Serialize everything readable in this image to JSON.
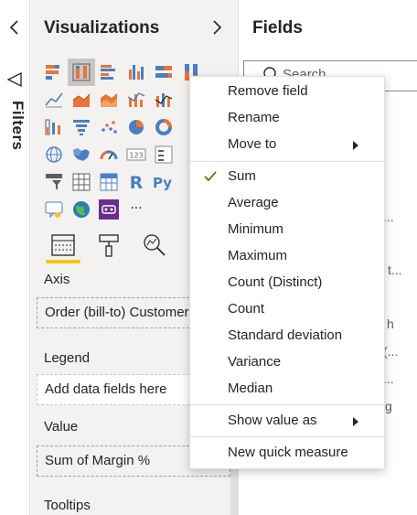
{
  "filters_rail": {
    "label": "Filters",
    "collapse_icon": "chevron-left-icon",
    "funnel_icon": "funnel-icon"
  },
  "visualizations": {
    "title": "Visualizations",
    "expand_icon": "chevron-right-icon",
    "gallery": [
      [
        "stacked-bar-chart-icon",
        "stacked-column-chart-icon",
        "clustered-bar-chart-icon",
        "clustered-column-chart-icon",
        "100-stacked-bar-chart-icon",
        "100-stacked-column-chart-icon"
      ],
      [
        "line-chart-icon",
        "area-chart-icon",
        "stacked-area-chart-icon",
        "line-and-column-chart-icon",
        "line-and-stacked-column-chart-icon"
      ],
      [
        "ribbon-chart-icon",
        "funnel-chart-icon",
        "scatter-chart-icon",
        "pie-chart-icon",
        "donut-chart-icon"
      ],
      [
        "globe-map-icon",
        "filled-map-icon",
        "gauge-icon",
        "card-icon",
        "multi-row-card-icon"
      ],
      [
        "slicer-icon",
        "table-icon",
        "matrix-icon",
        "r-visual-icon",
        "python-visual-icon"
      ],
      [
        "key-influencers-icon",
        "arcgis-map-icon",
        "custom-visual-icon",
        "more-visuals-icon"
      ]
    ],
    "text_glyphs": {
      "r": "R",
      "py": "Py",
      "more": "···",
      "card": "123"
    },
    "tabs": [
      "fields-tab-icon",
      "format-paintbrush-icon",
      "analytics-magnifier-icon"
    ],
    "sections": {
      "axis": {
        "label": "Axis",
        "value": "Order (bill-to) Customer"
      },
      "legend": {
        "label": "Legend",
        "placeholder": "Add data fields here"
      },
      "value": {
        "label": "Value",
        "value": "Sum of Margin %"
      },
      "tooltips": {
        "label": "Tooltips"
      }
    }
  },
  "fields": {
    "title": "Fields",
    "search_placeholder": "Search",
    "fragments": [
      "...",
      "t...",
      "h",
      "(...",
      "...",
      "g"
    ]
  },
  "context_menu": {
    "items": [
      {
        "label": "Remove field"
      },
      {
        "label": "Rename"
      },
      {
        "label": "Move to",
        "submenu": true
      },
      {
        "label": "Sum",
        "checked": true
      },
      {
        "label": "Average"
      },
      {
        "label": "Minimum"
      },
      {
        "label": "Maximum"
      },
      {
        "label": "Count (Distinct)"
      },
      {
        "label": "Count"
      },
      {
        "label": "Standard deviation"
      },
      {
        "label": "Variance"
      },
      {
        "label": "Median"
      },
      {
        "label": "Show value as",
        "submenu": true
      },
      {
        "label": "New quick measure"
      }
    ]
  },
  "colors": {
    "accent_yellow": "#f2c811",
    "check_green": "#498205",
    "pane_bg": "#f3f2f1",
    "selected_visual": "#c8c6c4"
  }
}
